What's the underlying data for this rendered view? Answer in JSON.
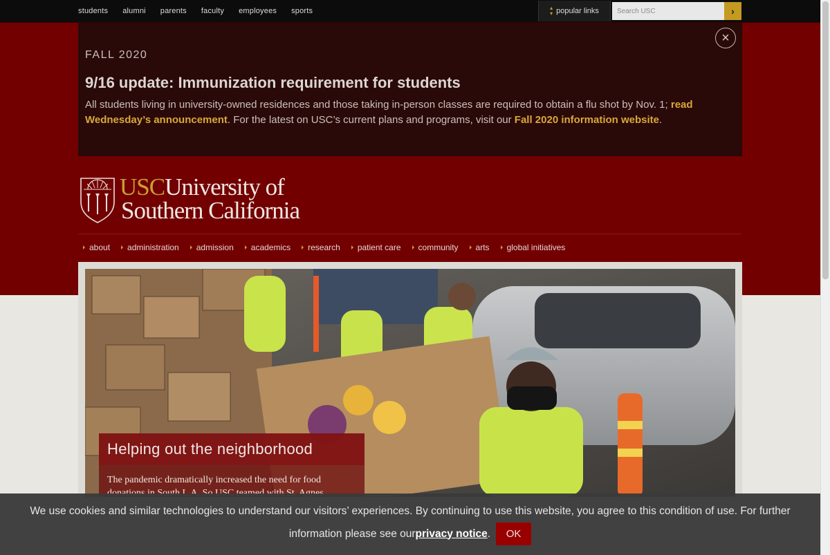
{
  "top_links": [
    "students",
    "alumni",
    "parents",
    "faculty",
    "employees",
    "sports"
  ],
  "popular_links": "popular links",
  "search": {
    "placeholder": "Search USC",
    "go": "›"
  },
  "alert": {
    "kicker": "FALL 2020",
    "title": "9/16 update: Immunization requirement for students",
    "text_before": "All students living in university-owned residences and those taking in-person classes are required to obtain a flu shot by Nov. 1; ",
    "link1": "read Wednesday’s announcement",
    "text_middle": ". For the latest on USC’s current plans and programs, visit our ",
    "link2": "Fall 2020 information website",
    "text_after": ".",
    "close": "×"
  },
  "logo": {
    "abbr": "USC",
    "line1": "University of",
    "line2": "Southern California"
  },
  "main_nav": [
    "about",
    "administration",
    "admission",
    "academics",
    "research",
    "patient care",
    "community",
    "arts",
    "global initiatives"
  ],
  "hero": {
    "title": "Helping out the neighborhood",
    "body": "The pandemic dramatically increased the need for food donations in South L.A. So USC teamed with St. Agnes"
  },
  "cookie": {
    "line1": "We use cookies and similar technologies to understand our visitors’ experiences. By continuing to use this website, you agree to this condition of use. For further",
    "line2_before": "information please see our ",
    "link": "privacy notice",
    "line2_after": ".",
    "ok": "OK"
  },
  "colors": {
    "cardinal": "#720000",
    "gold": "#c9a032",
    "dark": "#2a0909"
  }
}
